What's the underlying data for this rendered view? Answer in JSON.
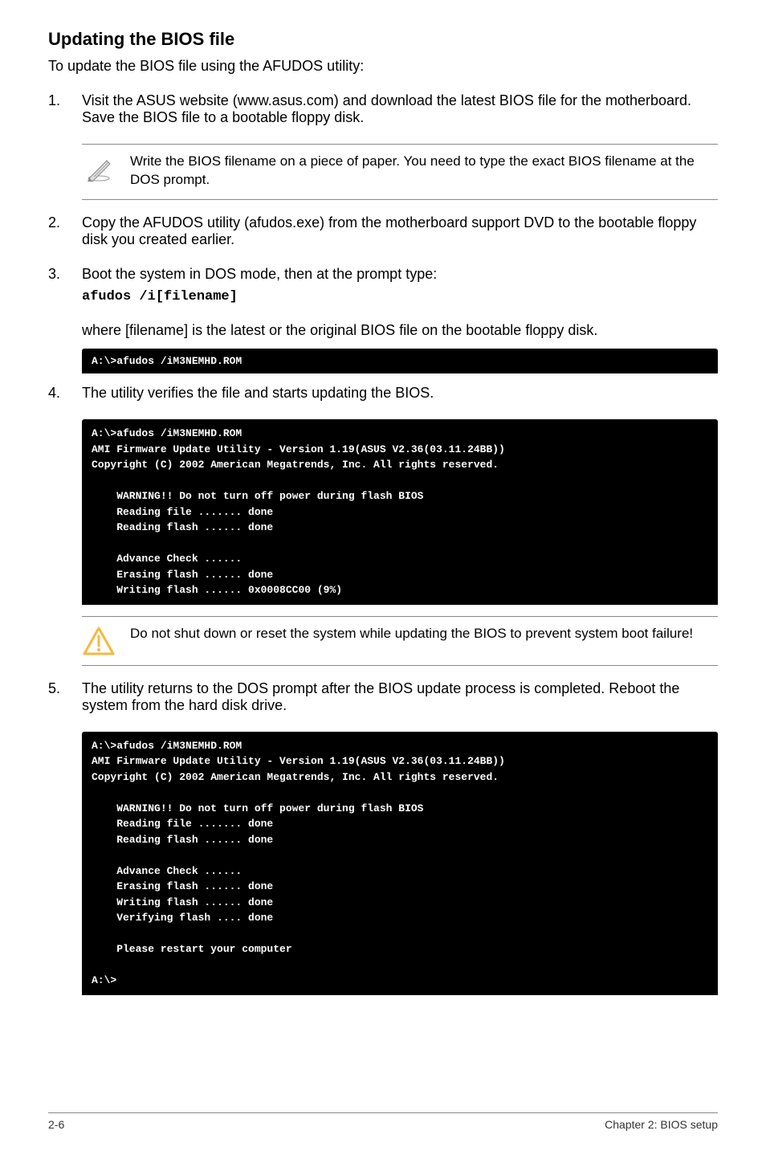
{
  "heading": "Updating the BIOS file",
  "intro": "To update the BIOS file using the AFUDOS utility:",
  "step1": {
    "num": "1.",
    "text": "Visit the ASUS website (www.asus.com) and download the latest BIOS file for the motherboard. Save the BIOS file to a bootable floppy disk."
  },
  "note1": "Write the BIOS filename on a piece of paper. You need to type the exact BIOS filename at the DOS prompt.",
  "step2": {
    "num": "2.",
    "text": "Copy the AFUDOS utility (afudos.exe) from the motherboard support DVD to the bootable floppy disk you created earlier."
  },
  "step3": {
    "num": "3.",
    "line1": "Boot the system in DOS mode, then at the prompt type:",
    "cmd": "afudos /i[filename]"
  },
  "where_line": "where [filename] is the latest or the original BIOS file on the bootable floppy disk.",
  "terminal1": "A:\\>afudos /iM3NEMHD.ROM",
  "step4": {
    "num": "4.",
    "text": "The utility verifies the file and starts updating the BIOS."
  },
  "terminal2": "A:\\>afudos /iM3NEMHD.ROM\nAMI Firmware Update Utility - Version 1.19(ASUS V2.36(03.11.24BB))\nCopyright (C) 2002 American Megatrends, Inc. All rights reserved.\n\n    WARNING!! Do not turn off power during flash BIOS\n    Reading file ....... done\n    Reading flash ...... done\n\n    Advance Check ......\n    Erasing flash ...... done\n    Writing flash ...... 0x0008CC00 (9%)",
  "warn1": "Do not shut down or reset the system while updating the BIOS to prevent system boot failure!",
  "step5": {
    "num": "5.",
    "text": "The utility returns to the DOS prompt after the BIOS update process is completed. Reboot the system from the hard disk drive."
  },
  "terminal3": "A:\\>afudos /iM3NEMHD.ROM\nAMI Firmware Update Utility - Version 1.19(ASUS V2.36(03.11.24BB))\nCopyright (C) 2002 American Megatrends, Inc. All rights reserved.\n\n    WARNING!! Do not turn off power during flash BIOS\n    Reading file ....... done\n    Reading flash ...... done\n\n    Advance Check ......\n    Erasing flash ...... done\n    Writing flash ...... done\n    Verifying flash .... done\n\n    Please restart your computer\n\nA:\\>",
  "footer": {
    "left": "2-6",
    "right": "Chapter 2: BIOS setup"
  }
}
